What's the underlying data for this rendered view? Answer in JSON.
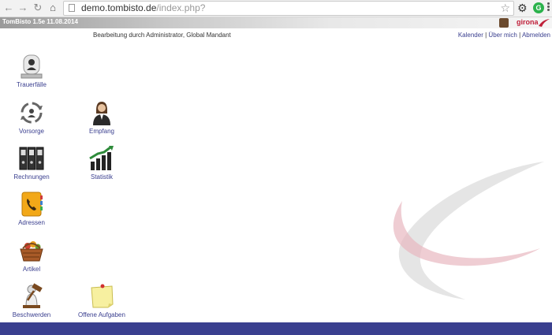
{
  "browser": {
    "url_host": "demo.tombisto.de",
    "url_path": "/index.php?"
  },
  "app": {
    "version": "TomBisto 1.5e 11.08.2014",
    "brand": "girona",
    "subline": "Bearbeitung durch Administrator, Global Mandant"
  },
  "toplinks": {
    "kalender": "Kalender",
    "ueber_mich": "Über mich",
    "abmelden": "Abmelden",
    "sep": "|"
  },
  "tiles": {
    "trauerfaelle": "Trauerfälle",
    "vorsorge": "Vorsorge",
    "empfang": "Empfang",
    "rechnungen": "Rechnungen",
    "statistik": "Statistik",
    "adressen": "Adressen",
    "artikel": "Artikel",
    "beschwerden": "Beschwerden",
    "offene_aufgaben": "Offene Aufgaben"
  },
  "colors": {
    "link": "#3a3f8f",
    "footer": "#3a3f8f",
    "brand": "#c0203a"
  }
}
